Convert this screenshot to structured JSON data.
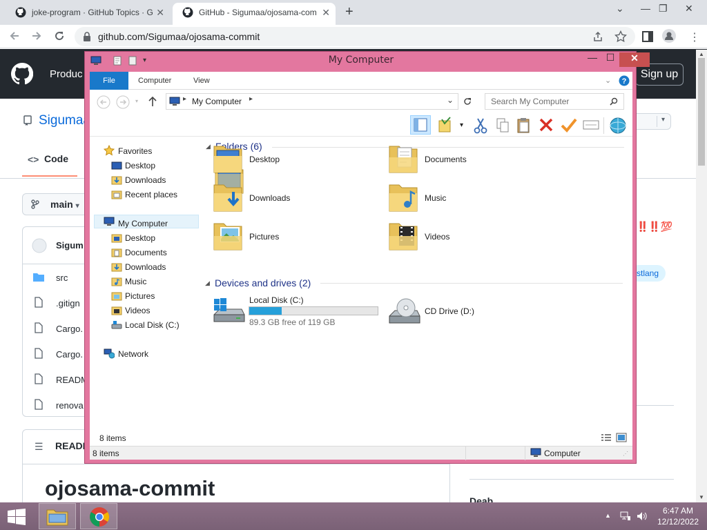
{
  "browser": {
    "tabs": [
      {
        "title": "joke-program · GitHub Topics · G",
        "close": "✕"
      },
      {
        "title": "GitHub - Sigumaa/ojosama-com",
        "close": "✕"
      }
    ],
    "new_tab": "+",
    "window_controls": [
      "⌄",
      "—",
      "❐",
      "✕"
    ],
    "url": "github.com/Sigumaa/ojosama-commit"
  },
  "github": {
    "products": "Produc",
    "signup": "Sign up",
    "repo_title": "Sigumaa",
    "code_tab": "Code",
    "branch": "main",
    "owner_row": "Sigum",
    "files": [
      "src",
      ".gitign",
      "Cargo.",
      "Cargo.",
      "READM",
      "renova"
    ],
    "readme_label": "READM",
    "readme_heading": "ojosama-commit",
    "emoji_text": "‼️‼️💯",
    "topic": "stlang",
    "readme_section_partial": "Deab"
  },
  "explorer": {
    "title": "My Computer",
    "window_buttons": {
      "minimize": "—",
      "maximize": "☐",
      "close": "✕"
    },
    "ribbon_tabs": {
      "file": "File",
      "computer": "Computer",
      "view": "View"
    },
    "path": "My Computer",
    "search_placeholder": "Search My Computer",
    "nav": {
      "favorites": "Favorites",
      "favorites_items": [
        "Desktop",
        "Downloads",
        "Recent places"
      ],
      "my_computer": "My Computer",
      "computer_items": [
        "Desktop",
        "Documents",
        "Downloads",
        "Music",
        "Pictures",
        "Videos",
        "Local Disk (C:)"
      ],
      "network": "Network"
    },
    "folders_heading": "Folders (6)",
    "folders": [
      "Desktop",
      "Documents",
      "Downloads",
      "Music",
      "Pictures",
      "Videos"
    ],
    "drives_heading": "Devices and drives (2)",
    "drives": [
      {
        "name": "Local Disk (C:)",
        "free_text": "89.3 GB free of 119 GB",
        "used_fraction": 0.25
      },
      {
        "name": "CD Drive (D:)"
      }
    ],
    "item_count": "8 items",
    "status_left": "8 items",
    "status_right": "Computer",
    "colors": {
      "frame": "#e3779f",
      "accent": "#1979ca",
      "close": "#c75050"
    }
  },
  "taskbar": {
    "time": "6:47 AM",
    "date": "12/12/2022"
  }
}
